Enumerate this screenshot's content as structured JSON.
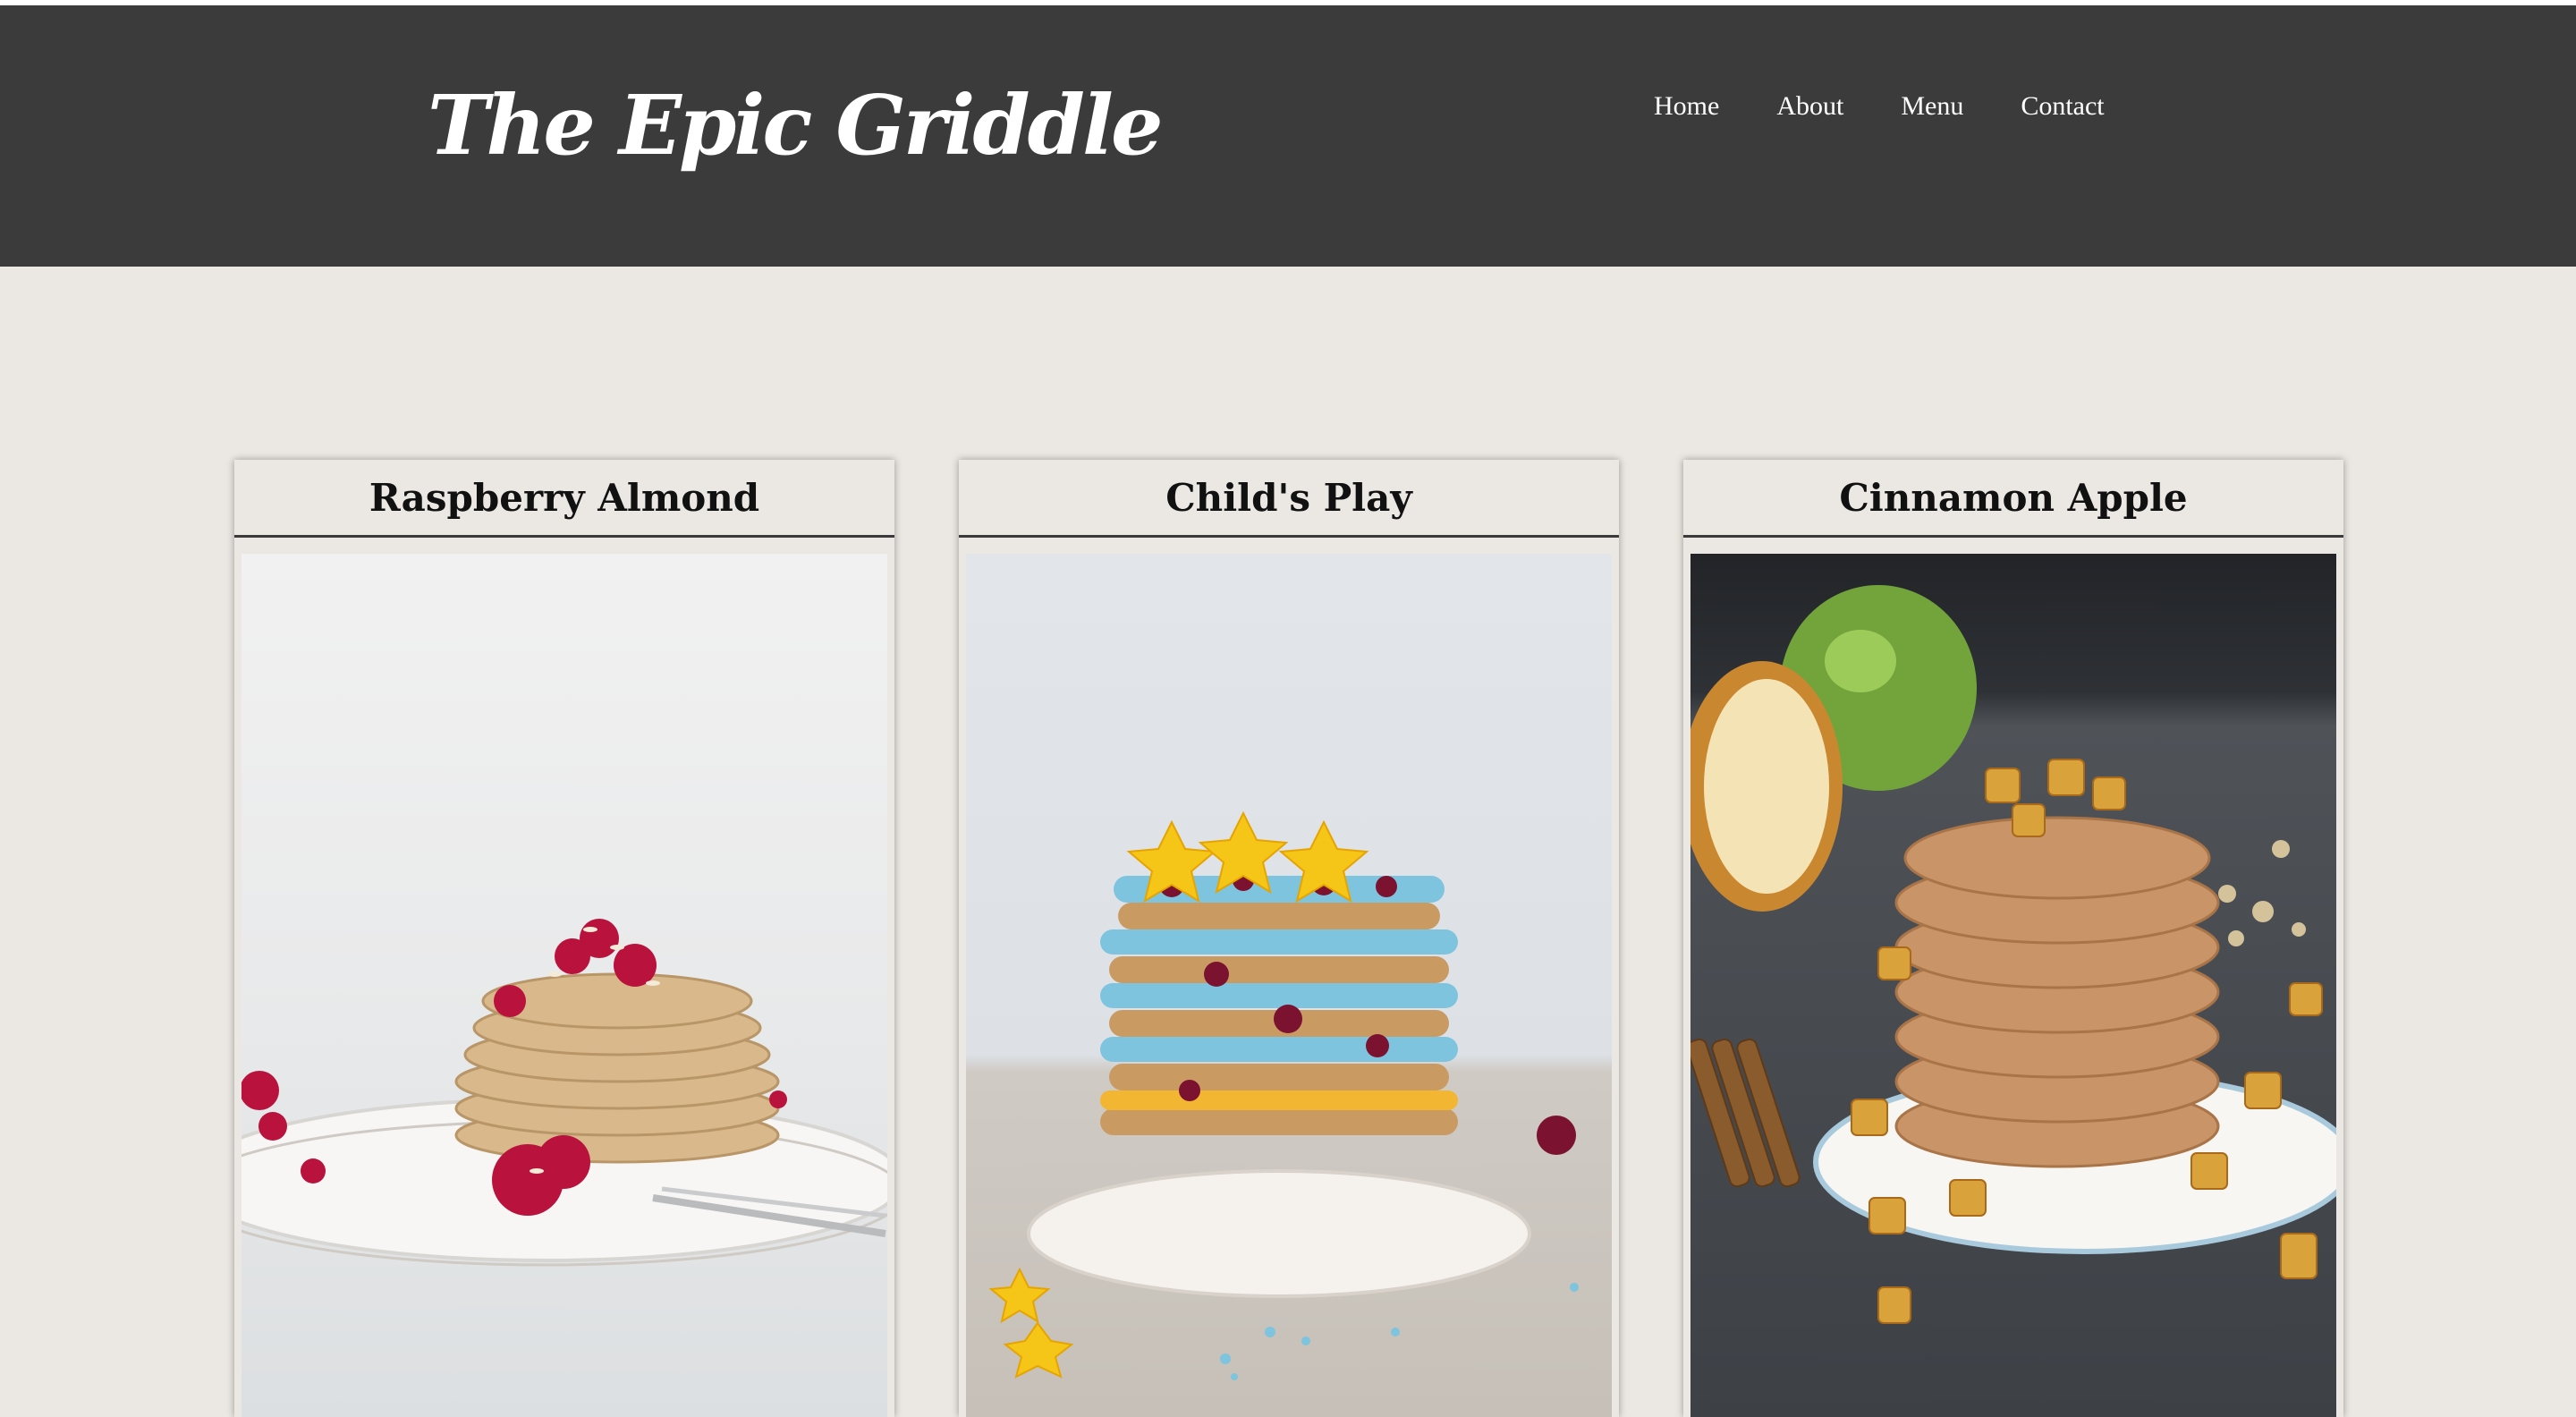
{
  "site": {
    "title": "The Epic Griddle"
  },
  "nav": {
    "items": [
      "Home",
      "About",
      "Menu",
      "Contact"
    ]
  },
  "cards": [
    {
      "title": "Raspberry Almond"
    },
    {
      "title": "Child's Play"
    },
    {
      "title": "Cinnamon Apple"
    }
  ],
  "colors": {
    "header": "#3b3b3b",
    "page": "#ebe7e2",
    "title_rule": "#3b3b3b"
  }
}
